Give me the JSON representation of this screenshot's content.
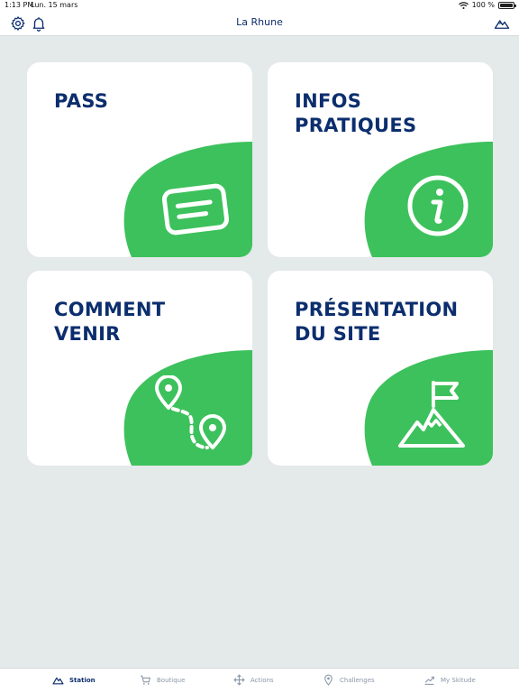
{
  "status_bar": {
    "time": "1:13 PM",
    "date": "Lun. 15 mars",
    "battery": "100 %"
  },
  "header": {
    "title": "La Rhune"
  },
  "cards": [
    {
      "line1": "PASS",
      "line2": "",
      "icon": "ticket-icon"
    },
    {
      "line1": "INFOS",
      "line2": "PRATIQUES",
      "icon": "info-icon"
    },
    {
      "line1": "COMMENT",
      "line2": "VENIR",
      "icon": "route-pins-icon"
    },
    {
      "line1": "PRÉSENTATION",
      "line2": "DU SITE",
      "icon": "mountain-flag-icon"
    }
  ],
  "tabs": [
    {
      "label": "Station",
      "icon": "mountain-icon",
      "active": true
    },
    {
      "label": "Boutique",
      "icon": "cart-icon",
      "active": false
    },
    {
      "label": "Actions",
      "icon": "move-arrows-icon",
      "active": false
    },
    {
      "label": "Challenges",
      "icon": "map-pin-icon",
      "active": false
    },
    {
      "label": "My Skitude",
      "icon": "chart-up-icon",
      "active": false
    }
  ],
  "colors": {
    "accent_green": "#3dc15c",
    "title_navy": "#0c2e6e",
    "background": "#e4e9ea"
  }
}
